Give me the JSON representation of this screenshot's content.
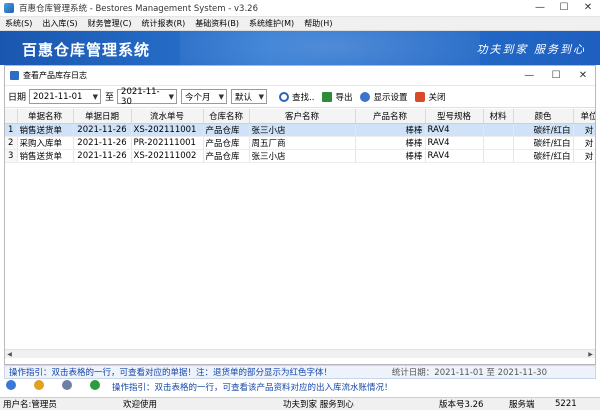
{
  "window": {
    "title": "百惠仓库管理系统 - Bestores Management System - v3.26"
  },
  "menu": [
    "系统(S)",
    "出入库(S)",
    "财务管理(C)",
    "统计报表(R)",
    "基础资料(B)",
    "系统维护(M)",
    "帮助(H)"
  ],
  "banner": {
    "logo": "百惠仓库管理系统",
    "slogan": "功夫到家  服务到心"
  },
  "child": {
    "title": "查看产品库存日志"
  },
  "filter": {
    "date_label": "日期",
    "date_from": "2021-11-01",
    "to_label": "至",
    "date_to": "2021-11-30",
    "period": "今个月",
    "mode": "默认",
    "search": "查找..",
    "export": "导出",
    "settings": "显示设置",
    "close": "关闭"
  },
  "table": {
    "columns": [
      "单据名称",
      "单据日期",
      "流水单号",
      "仓库名称",
      "客户名称",
      "产品名称",
      "型号规格",
      "材料",
      "颜色",
      "单位"
    ],
    "rows": [
      {
        "no": "1",
        "cells": [
          "销售送货单",
          "2021-11-26",
          "XS-202111001",
          "产品仓库",
          "张三小店",
          "棒棒",
          "RAV4",
          "",
          "碳纤/红白",
          "对"
        ]
      },
      {
        "no": "2",
        "cells": [
          "采购入库单",
          "2021-11-26",
          "PR-202111001",
          "产品仓库",
          "周五厂商",
          "棒棒",
          "RAV4",
          "",
          "碳纤/红白",
          "对"
        ]
      },
      {
        "no": "3",
        "cells": [
          "销售送货单",
          "2021-11-26",
          "XS-202111002",
          "产品仓库",
          "张三小店",
          "棒棒",
          "RAV4",
          "",
          "碳纤/红白",
          "对"
        ]
      }
    ]
  },
  "child_status": {
    "hint": "操作指引：双击表格的一行，可查看对应的单据！注：退货单的部分显示为红色字体！",
    "stat": "统计日期：2021-11-01 至 2021-11-30"
  },
  "bottom_hint": "操作指引：双击表格的一行，可查看该产品资料对应的出入库流水账情况！",
  "statusbar": {
    "user": "用户名:管理员",
    "welcome": "欢迎使用",
    "motto": "功夫到家 服务到心",
    "version": "版本号3.26",
    "service": "服务端",
    "extra": "5221"
  }
}
